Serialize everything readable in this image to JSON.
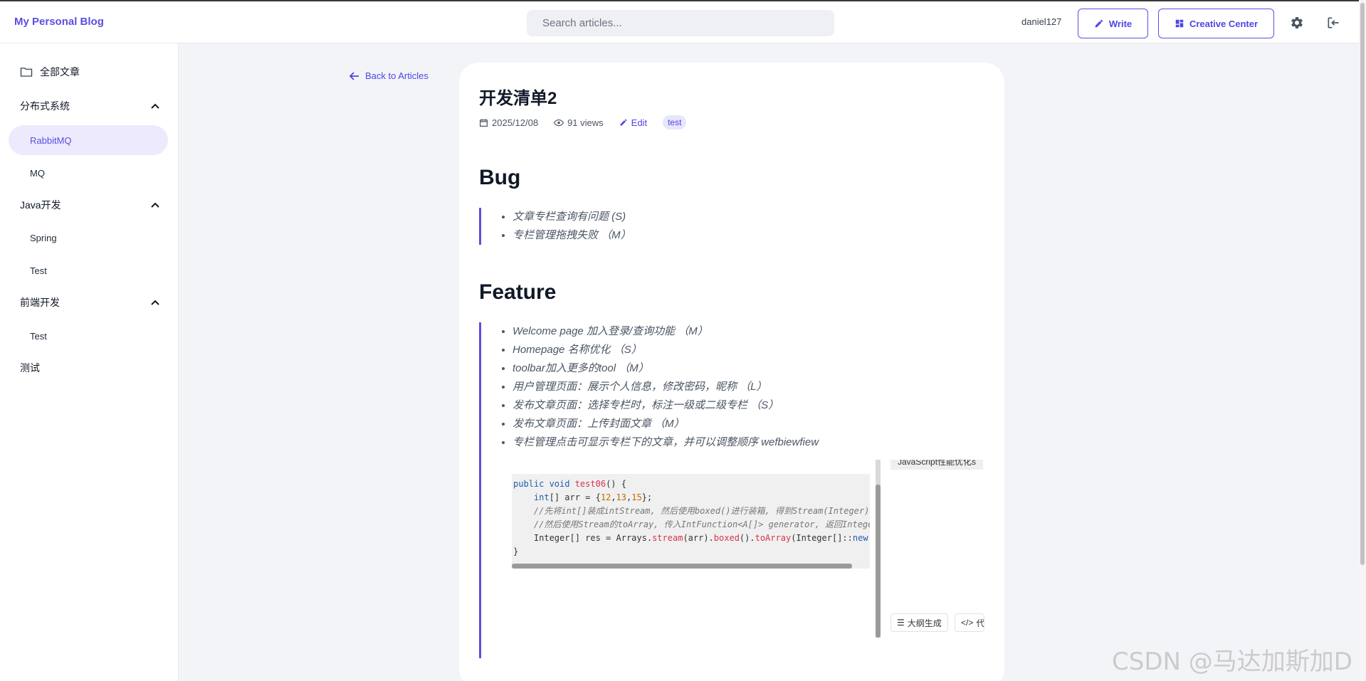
{
  "app": {
    "brand": "My Personal Blog",
    "search_placeholder": "Search articles...",
    "username": "daniel127",
    "write_label": "Write",
    "creative_label": "Creative Center"
  },
  "sidebar": {
    "all_label": "全部文章",
    "groups": [
      {
        "label": "分布式系统",
        "items": [
          "RabbitMQ",
          "MQ"
        ]
      },
      {
        "label": "Java开发",
        "items": [
          "Spring",
          "Test"
        ]
      },
      {
        "label": "前端开发",
        "items": [
          "Test"
        ]
      }
    ],
    "extra": "测试",
    "active_item": "RabbitMQ"
  },
  "nav": {
    "back_label": "Back to Articles"
  },
  "article": {
    "title": "开发清单2",
    "date": "2025/12/08",
    "views": "91 views",
    "edit_label": "Edit",
    "tag": "test",
    "sections": [
      {
        "heading": "Bug",
        "items": [
          "文章专栏查询有问题 (S)",
          "专栏管理拖拽失败 （M）"
        ]
      },
      {
        "heading": "Feature",
        "items": [
          "Welcome page 加入登录/查询功能 （M）",
          "Homepage 名称优化 （S）",
          "toolbar加入更多的tool （M）",
          "用户管理页面：展示个人信息，修改密码，昵称 （L）",
          "发布文章页面：选择专栏时，标注一级或二级专栏 （S）",
          "发布文章页面：上传封面文章 （M）",
          "专栏管理点击可显示专栏下的文章，并可以调整顺序 wefbiewfiew"
        ]
      }
    ]
  },
  "embed": {
    "side_chip": "JavaScript性能优化s",
    "btn_outline": "大纲生成",
    "btn_code": "代",
    "code": {
      "line1": {
        "kw": "public void ",
        "fn": "test06",
        "rest": "() {"
      },
      "line2": {
        "kw": "int",
        "mid": "[] arr = {",
        "n1": "12",
        "c1": ",",
        "n2": "13",
        "c2": ",",
        "n3": "15",
        "end": "};"
      },
      "line3": "//先将int[]装成intStream, 然后使用boxed()进行装箱, 得到Stream(Integer)",
      "line4": "//然后使用Stream的toArray, 传入IntFunction<A[]> generator, 返回Intege",
      "line5": {
        "a": "Integer[] res = Arrays.",
        "f1": "stream",
        "b": "(arr).",
        "f2": "boxed",
        "c": "().",
        "f3": "toArray",
        "d": "(Integer[]::",
        "k": "new"
      },
      "line6": "}"
    }
  },
  "watermark": "CSDN @马达加斯加D",
  "colors": {
    "accent": "#5b4fe0",
    "background": "#f3f4f8"
  }
}
